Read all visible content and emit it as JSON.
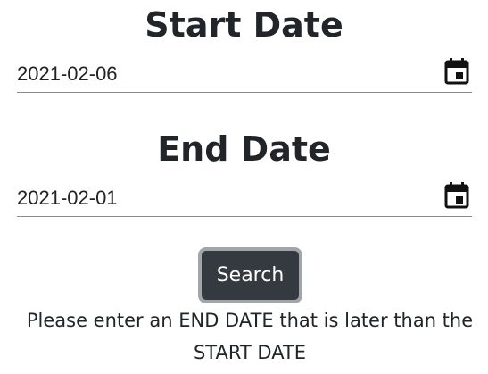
{
  "start_date": {
    "heading": "Start Date",
    "value": "2021-02-06",
    "icon": "calendar-icon"
  },
  "end_date": {
    "heading": "End Date",
    "value": "2021-02-01",
    "icon": "calendar-icon"
  },
  "search_button": {
    "label": "Search"
  },
  "validation_message": {
    "line1": "Please enter an END DATE that is later than the",
    "line2": "START DATE"
  },
  "colors": {
    "button_bg": "#343a40",
    "button_border": "#a3a6a9",
    "text": "#212529",
    "underline": "#8a8a8a"
  }
}
